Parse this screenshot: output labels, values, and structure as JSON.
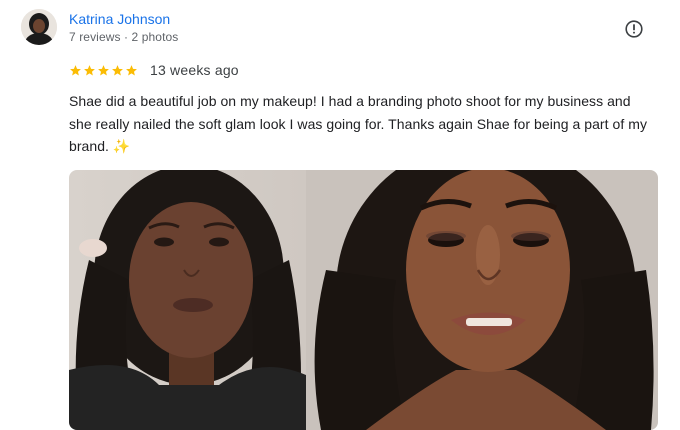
{
  "review": {
    "reviewer_name": "Katrina Johnson",
    "reviewer_meta": "7 reviews · 2 photos",
    "rating": 5,
    "max_rating": 5,
    "date": "13 weeks ago",
    "text": "Shae did a beautiful job on my makeup! I had a branding photo shoot for my business and she really nailed the soft glam look I was going for. Thanks again Shae for being a part of my brand. ✨",
    "icons": {
      "avatar": "reviewer-avatar",
      "flag": "report-flag-icon",
      "star": "star-icon"
    },
    "colors": {
      "name": "#1a73e8",
      "star": "#fbbc04",
      "meta": "#5f6368"
    },
    "photos": [
      {
        "name": "before-photo"
      },
      {
        "name": "after-photo"
      }
    ]
  }
}
